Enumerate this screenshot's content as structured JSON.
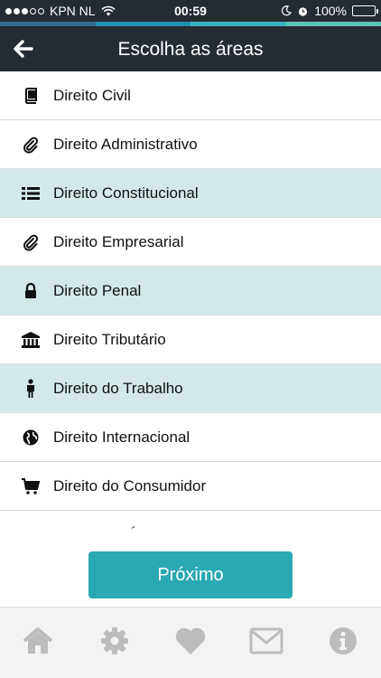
{
  "status_bar": {
    "carrier": "KPN NL",
    "time": "00:59",
    "battery": "100%"
  },
  "accent_colors": [
    "#2f6f8f",
    "#1f8fb6",
    "#39b2c0",
    "#5ac3b6"
  ],
  "header": {
    "title": "Escolha as áreas",
    "back_icon": "arrow-left-icon"
  },
  "areas": [
    {
      "label": "Direito Civil",
      "icon": "book-icon",
      "selected": false
    },
    {
      "label": "Direito Administrativo",
      "icon": "paperclip-icon",
      "selected": false
    },
    {
      "label": "Direito Constitucional",
      "icon": "list-icon",
      "selected": true
    },
    {
      "label": "Direito Empresarial",
      "icon": "paperclip-icon",
      "selected": false
    },
    {
      "label": "Direito Penal",
      "icon": "lock-icon",
      "selected": true
    },
    {
      "label": "Direito Tributário",
      "icon": "bank-icon",
      "selected": false
    },
    {
      "label": "Direito do Trabalho",
      "icon": "person-icon",
      "selected": true
    },
    {
      "label": "Direito Internacional",
      "icon": "globe-icon",
      "selected": false
    },
    {
      "label": "Direito do Consumidor",
      "icon": "cart-icon",
      "selected": false
    },
    {
      "label": "Código de Ética e Disciplina",
      "icon": "edit-icon",
      "selected": false
    }
  ],
  "next_button": {
    "label": "Próximo"
  },
  "tabbar": [
    "home-icon",
    "gear-icon",
    "heart-icon",
    "envelope-icon",
    "info-icon"
  ],
  "colors": {
    "header_bg": "#242b33",
    "selected_row": "#d4e8ea",
    "button": "#2aa9b3",
    "tab_icon": "#bcbcbc"
  }
}
